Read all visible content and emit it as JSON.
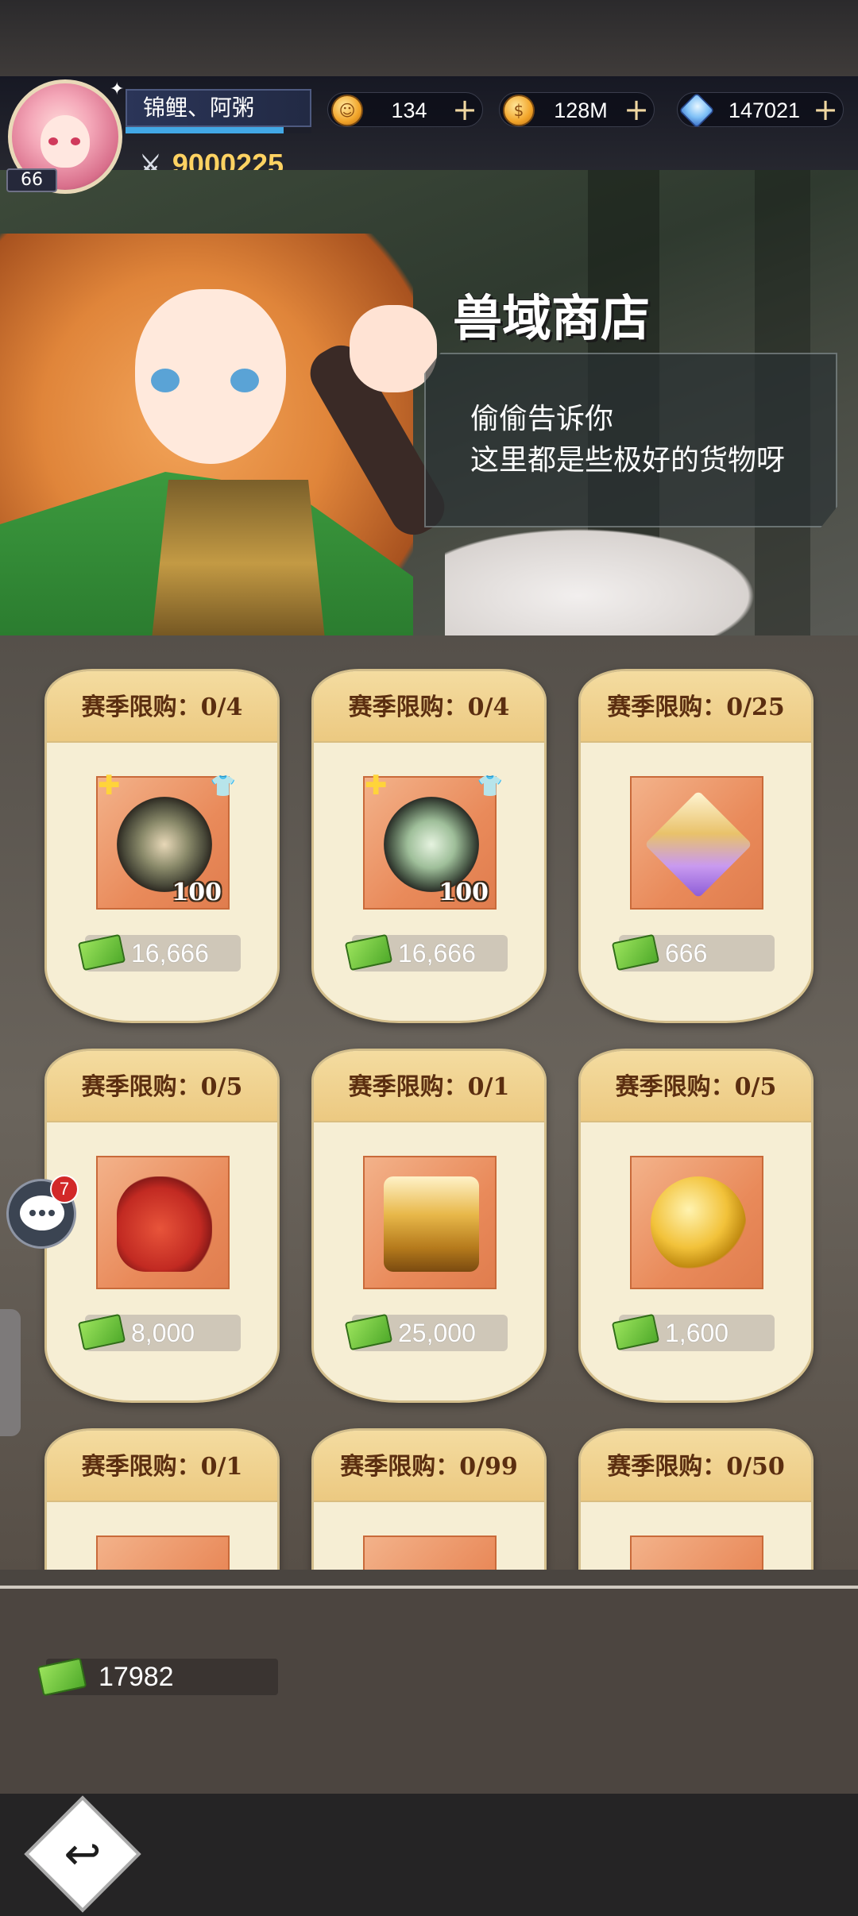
{
  "player": {
    "name": "锦鲤、阿粥",
    "level": "66",
    "power": "9000225"
  },
  "currencies": [
    {
      "icon": "stamina-coin-icon",
      "value": "134"
    },
    {
      "icon": "gold-coin-icon",
      "value": "128M"
    },
    {
      "icon": "diamond-icon",
      "value": "147021"
    }
  ],
  "banner": {
    "title": "兽域商店",
    "line1": "偷偷告诉你",
    "line2": "这里都是些极好的货物呀"
  },
  "items": [
    {
      "limit": "赛季限购：0/4",
      "qty": "100",
      "price": "16,666",
      "icon": "deer-skull-shield-icon"
    },
    {
      "limit": "赛季限购：0/4",
      "qty": "100",
      "price": "16,666",
      "icon": "horned-orb-icon"
    },
    {
      "limit": "赛季限购：0/25",
      "qty": "",
      "price": "666",
      "icon": "crystal-star-icon"
    },
    {
      "limit": "赛季限购：0/5",
      "qty": "",
      "price": "8,000",
      "icon": "red-gift-bag-icon"
    },
    {
      "limit": "赛季限购：0/1",
      "qty": "",
      "price": "25,000",
      "icon": "golden-chest-icon"
    },
    {
      "limit": "赛季限购：0/5",
      "qty": "",
      "price": "1,600",
      "icon": "gold-coin-item-icon"
    },
    {
      "limit": "赛季限购：0/1",
      "qty": "",
      "price": "",
      "icon": "item-icon"
    },
    {
      "limit": "赛季限购：0/99",
      "qty": "",
      "price": "",
      "icon": "item-icon"
    },
    {
      "limit": "赛季限购：0/50",
      "qty": "",
      "price": "",
      "icon": "item-icon"
    }
  ],
  "chat": {
    "unread": "7"
  },
  "balance": {
    "value": "17982",
    "icon": "ticket-icon"
  },
  "colors": {
    "accent": "#ffd262",
    "card": "#f6eed4",
    "card_header": "#ecc981",
    "price_ticket": "#4faa2a"
  }
}
